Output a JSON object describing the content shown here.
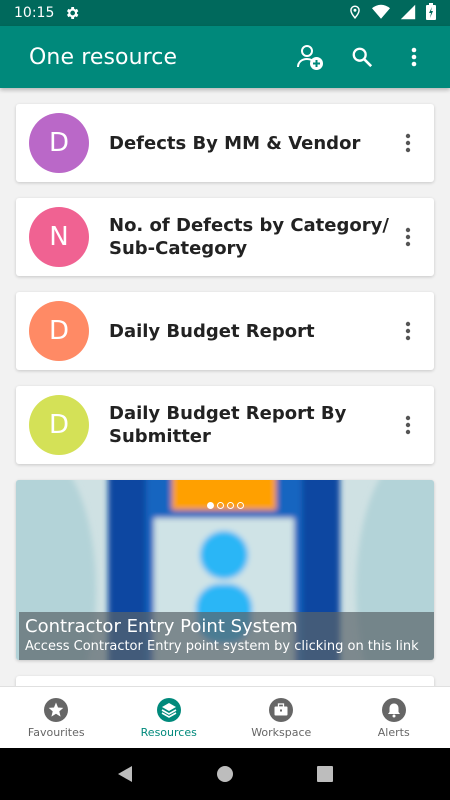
{
  "status_bar": {
    "time": "10:15"
  },
  "app_bar": {
    "title": "One resource"
  },
  "cards": [
    {
      "initial": "D",
      "label": "Defects By MM & Vendor",
      "color": "#ba68c8"
    },
    {
      "initial": "N",
      "label": "No. of Defects by Category/ Sub-Category",
      "color": "#f06292"
    },
    {
      "initial": "D",
      "label": "Daily Budget Report",
      "color": "#ff8a65"
    },
    {
      "initial": "D",
      "label": "Daily Budget Report By Submitter",
      "color": "#d4e157"
    }
  ],
  "banner": {
    "title": "Contractor Entry Point System",
    "subtitle": "Access Contractor Entry point system by clicking on this link",
    "slide_count": 4,
    "active_slide": 1
  },
  "bottom_nav": {
    "items": [
      {
        "label": "Favourites",
        "icon": "star-icon",
        "active": false
      },
      {
        "label": "Resources",
        "icon": "layers-icon",
        "active": true
      },
      {
        "label": "Workspace",
        "icon": "briefcase-icon",
        "active": false
      },
      {
        "label": "Alerts",
        "icon": "bell-icon",
        "active": false
      }
    ]
  },
  "colors": {
    "primary": "#00897b",
    "primary_dark": "#00695c"
  }
}
